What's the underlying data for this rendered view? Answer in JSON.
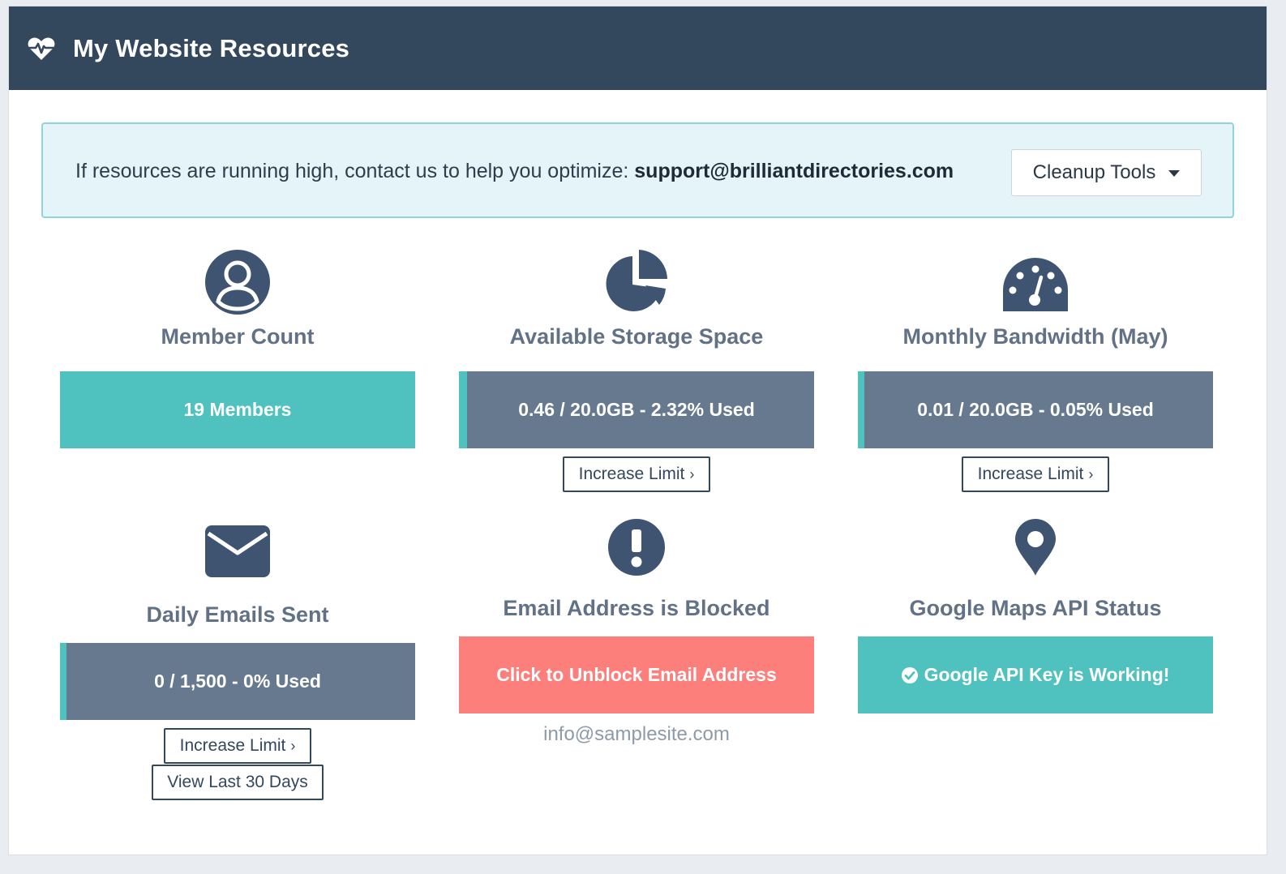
{
  "header": {
    "title": "My Website Resources",
    "icon": "heartbeat-icon"
  },
  "notice": {
    "text": "If resources are running high, contact us to help you optimize: ",
    "email": "support@brilliantdirectories.com",
    "cleanup_label": "Cleanup Tools"
  },
  "colors": {
    "header_bg": "#33475d",
    "teal": "#4fc2bf",
    "slate": "#66798e",
    "coral": "#fc7f7c",
    "notice_bg": "#e4f4f8",
    "notice_border": "#8ed4db"
  },
  "cards": {
    "members": {
      "title": "Member Count",
      "value": "19 Members",
      "icon": "user-icon"
    },
    "storage": {
      "title": "Available Storage Space",
      "value": "0.46 / 20.0GB - 2.32% Used",
      "percent_used": 2.32,
      "button": "Increase Limit",
      "icon": "pie-chart-icon"
    },
    "bandwidth": {
      "title": "Monthly Bandwidth (May)",
      "value": "0.01 / 20.0GB - 0.05% Used",
      "percent_used": 0.05,
      "button": "Increase Limit",
      "icon": "dashboard-icon"
    },
    "emails": {
      "title": "Daily Emails Sent",
      "value": "0 / 1,500 - 0% Used",
      "percent_used": 0,
      "button": "Increase Limit",
      "button2": "View Last 30 Days",
      "icon": "envelope-icon"
    },
    "blocked": {
      "title": "Email Address is Blocked",
      "value": "Click to Unblock Email Address",
      "email": "info@samplesite.com",
      "icon": "exclamation-circle-icon"
    },
    "maps": {
      "title": "Google Maps API Status",
      "value": "Google API Key is Working!",
      "icon": "map-marker-icon"
    }
  }
}
